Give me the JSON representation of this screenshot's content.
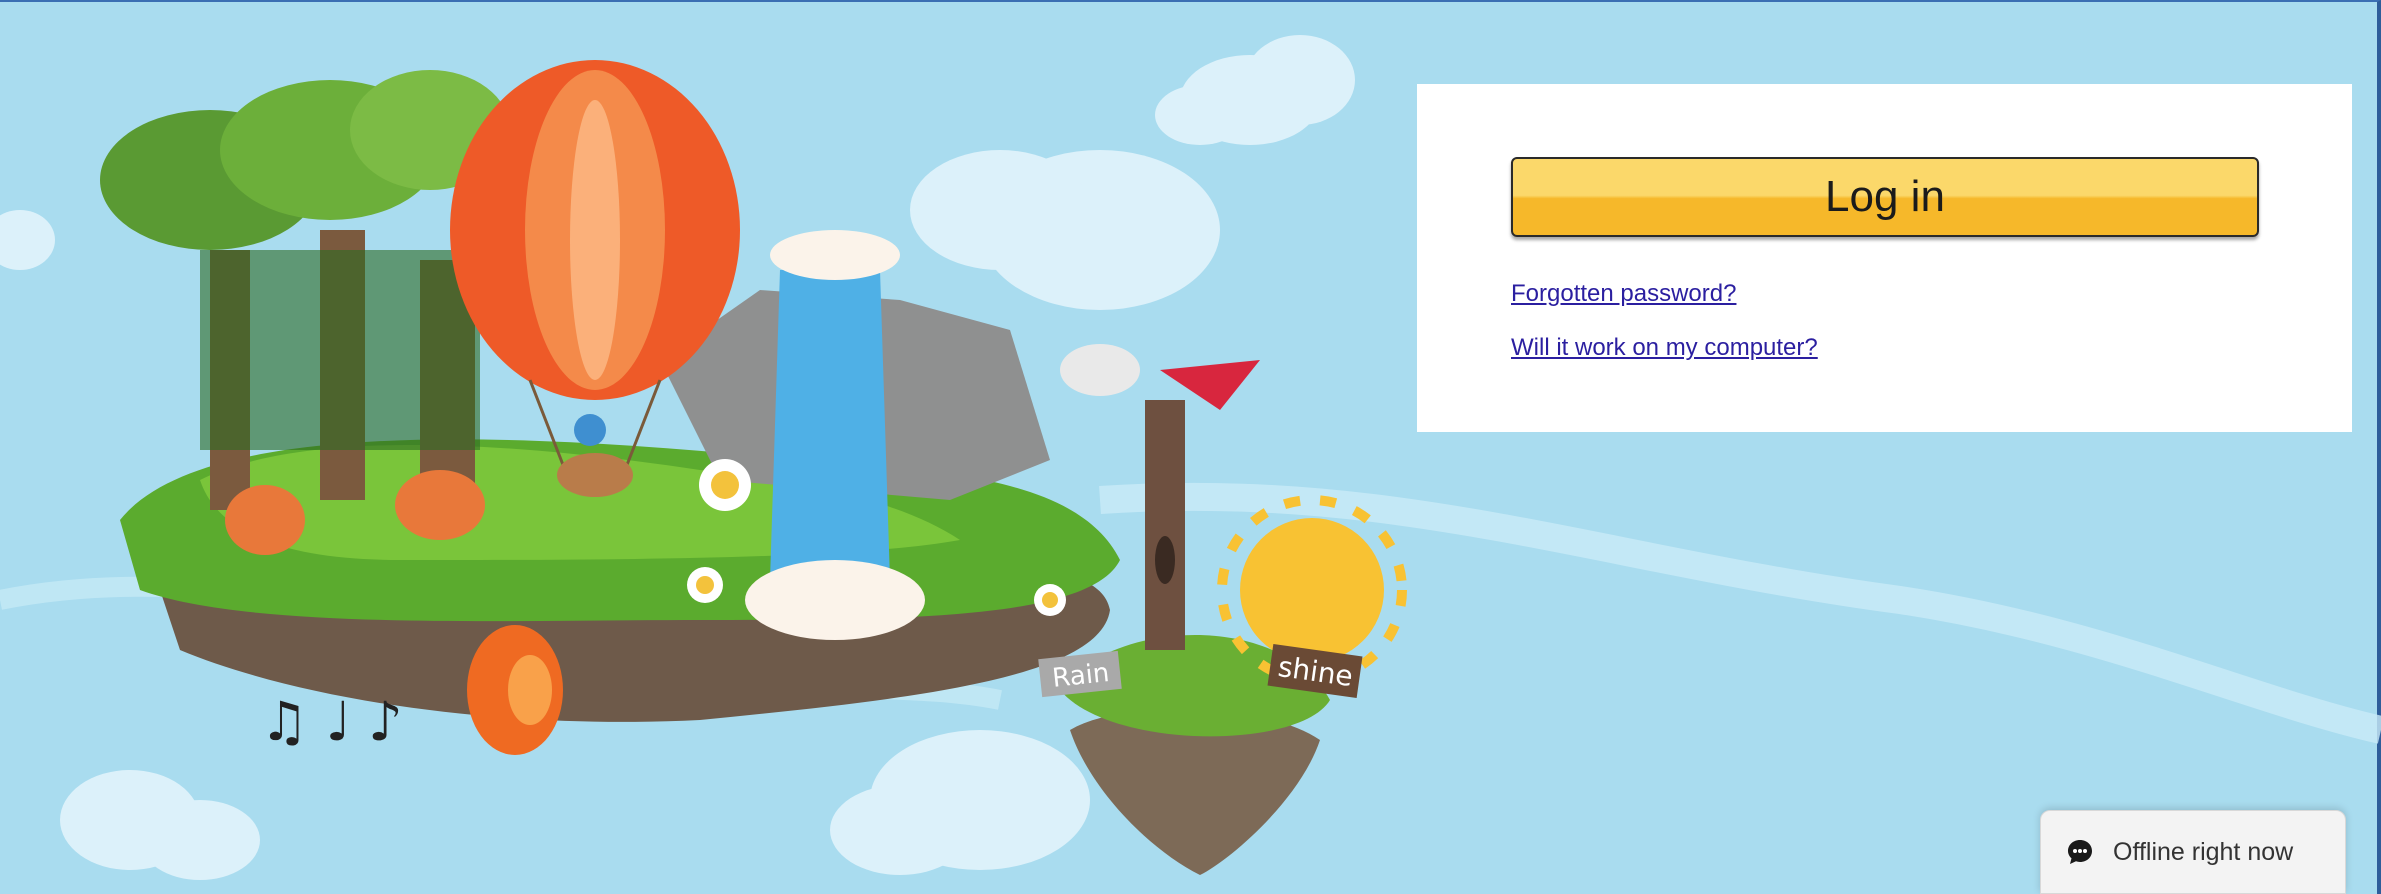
{
  "login": {
    "button_label": "Log in",
    "forgot_password": "Forgotten password?",
    "compatibility": "Will it work on my computer?"
  },
  "illustration": {
    "sign_rain": "Rain",
    "sign_shine": "shine"
  },
  "chat": {
    "status": "Offline right now",
    "icon": "chat-bubble-icon"
  },
  "colors": {
    "sky": "#a9dcef",
    "button": "#f6b82a",
    "link": "#2b1fa0"
  }
}
